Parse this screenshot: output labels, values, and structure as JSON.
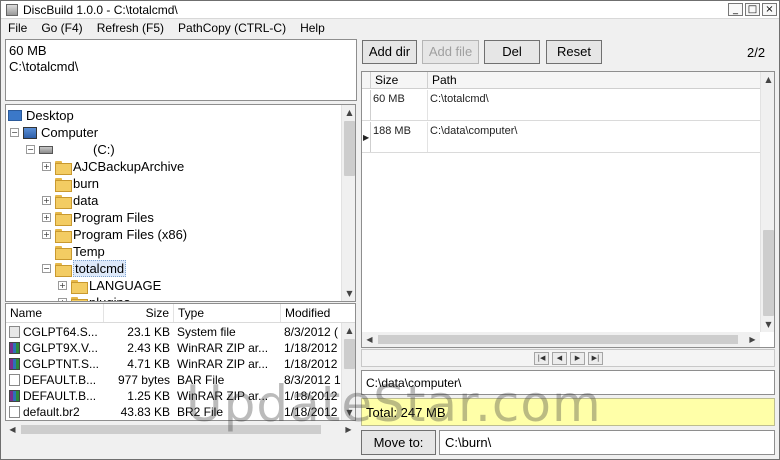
{
  "window": {
    "title": "DiscBuild 1.0.0 - C:\\totalcmd\\",
    "minimize_glyph": "_",
    "maximize_glyph": "□",
    "close_glyph": "×"
  },
  "menu": [
    "File",
    "Go (F4)",
    "Refresh (F5)",
    "PathCopy (CTRL-C)",
    "Help"
  ],
  "info": {
    "size": "60 MB",
    "path": "C:\\totalcmd\\"
  },
  "tree": {
    "items": [
      {
        "label": "Desktop",
        "icon": "desktop-icon"
      },
      {
        "label": "Computer",
        "icon": "computer-icon",
        "expander": "−"
      },
      {
        "label": "(C:)",
        "icon": "drive-icon",
        "expander": "−"
      },
      {
        "label": "AJCBackupArchive",
        "icon": "folder-icon",
        "expander": "+"
      },
      {
        "label": "burn",
        "icon": "folder-icon"
      },
      {
        "label": "data",
        "icon": "folder-icon",
        "expander": "+"
      },
      {
        "label": "Program Files",
        "icon": "folder-icon",
        "expander": "+"
      },
      {
        "label": "Program Files (x86)",
        "icon": "folder-icon",
        "expander": "+"
      },
      {
        "label": "Temp",
        "icon": "folder-icon"
      },
      {
        "label": "totalcmd",
        "icon": "folder-icon",
        "expander": "−"
      },
      {
        "label": "LANGUAGE",
        "icon": "folder-icon",
        "expander": "+"
      },
      {
        "label": "plugins",
        "icon": "folder-icon",
        "expander": "+"
      }
    ]
  },
  "files": {
    "columns": [
      "Name",
      "Size",
      "Type",
      "Modified"
    ],
    "rows": [
      {
        "name": "CGLPT64.S...",
        "size": "23.1 KB",
        "type": "System file",
        "modified": "8/3/2012 (",
        "icon": "system-file-icon"
      },
      {
        "name": "CGLPT9X.V...",
        "size": "2.43 KB",
        "type": "WinRAR ZIP ar...",
        "modified": "1/18/2012",
        "icon": "winrar-icon"
      },
      {
        "name": "CGLPTNT.S...",
        "size": "4.71 KB",
        "type": "WinRAR ZIP ar...",
        "modified": "1/18/2012",
        "icon": "winrar-icon"
      },
      {
        "name": "DEFAULT.B...",
        "size": "977 bytes",
        "type": "BAR File",
        "modified": "8/3/2012 1",
        "icon": "file-icon"
      },
      {
        "name": "DEFAULT.B...",
        "size": "1.25 KB",
        "type": "WinRAR ZIP ar...",
        "modified": "1/18/2012",
        "icon": "winrar-icon"
      },
      {
        "name": "default.br2",
        "size": "43.83 KB",
        "type": "BR2 File",
        "modified": "1/18/2012",
        "icon": "file-icon"
      }
    ]
  },
  "toolbar": {
    "add_dir": "Add dir",
    "add_file": "Add file",
    "del": "Del",
    "reset": "Reset"
  },
  "page_indicator": "2/2",
  "grid": {
    "columns": [
      "Size",
      "Path"
    ],
    "rows": [
      {
        "size": "60 MB",
        "path": "C:\\totalcmd\\"
      },
      {
        "size": "188 MB",
        "path": "C:\\data\\computer\\"
      }
    ]
  },
  "nav_glyphs": {
    "first": "|◀",
    "prev": "◀",
    "next": "▶",
    "last": "▶|"
  },
  "selected_path": "C:\\data\\computer\\",
  "total": "Total: 247 MB",
  "move_to": {
    "label": "Move to:",
    "value": "C:\\burn\\"
  },
  "watermark": "UpdateStar.com",
  "colors": {
    "total_bg": "#ffffa8",
    "selection": "#dde9fa"
  }
}
